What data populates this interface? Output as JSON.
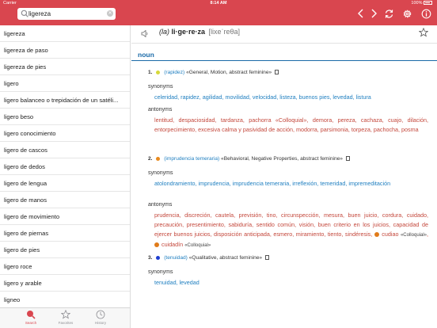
{
  "status": {
    "carrier": "Carrier",
    "time": "8:14 AM",
    "battery": "100%"
  },
  "search": {
    "value": "ligereza",
    "placeholder": "Search"
  },
  "list": [
    "ligereza",
    "ligereza de paso",
    "ligereza de pies",
    "ligero",
    "ligero balanceo o trepidación de un satéli...",
    "ligero beso",
    "ligero conocimiento",
    "ligero de cascos",
    "ligero de dedos",
    "ligero de lengua",
    "ligero de manos",
    "ligero de movimiento",
    "ligero de piernas",
    "ligero de pies",
    "ligero roce",
    "ligero y arable",
    "ligneo"
  ],
  "tabs": {
    "search": "Search",
    "favorites": "Favorites",
    "history": "History"
  },
  "entry": {
    "article": "(la)",
    "word": "li·ge·re·za",
    "ipa": "[lixeˈreθa]",
    "pos": "noun",
    "colors": {
      "accent": "#d9464f",
      "synonym": "#1f7fc0",
      "antonym": "#c4483c",
      "pos": "#1a6aa8"
    },
    "senses": [
      {
        "num": "1.",
        "dot": "#d7d93a",
        "gloss": "(rapidez)",
        "meta": "«General, Motion, abstract feminine»",
        "syn_label": "synonyms",
        "synonyms": [
          "celeridad",
          "rapidez",
          "agilidad",
          "movilidad",
          "velocidad",
          "listeza",
          "buenos pies",
          "levedad",
          "listura"
        ],
        "ant_label": "antonyms",
        "antonyms_text": "lentitud, despaciosidad, tardanza, pachorra «Colloquial», demora, pereza, cachaza, cuajo, dilación, entorpecimiento, excesiva calma y pasividad de acción, modorra, parsimonia, torpeza, pachocha, posma"
      },
      {
        "num": "2.",
        "dot": "#e88a1e",
        "gloss": "(imprudencia temeraria)",
        "meta": "«Behavioral, Negative Properties, abstract feminine»",
        "syn_label": "synonyms",
        "synonyms": [
          "atolondramiento",
          "imprudencia",
          "imprudencia temeraria",
          "irreflexión",
          "temeridad",
          "impremeditación"
        ],
        "ant_label": "antonyms",
        "antonyms_text": "prudencia, discreción, cautela, previsión, tino, circunspección, mesura, buen juicio, cordura, cuidado, precaución, presentimiento, sabiduría, sentido común, visión, buen criterio en los juicios, capacidad de ejercer buenos juicios, disposición anticipada, esmero, miramiento, tiento, sindéresis,",
        "ant_extra": [
          {
            "word": "cudiao",
            "note": "«Colloquial»"
          },
          {
            "word": "cuidadín",
            "note": "«Colloquial»"
          }
        ]
      },
      {
        "num": "3.",
        "dot": "#1f3fd1",
        "gloss": "(tenuidad)",
        "meta": "«Qualitative, abstract feminine»",
        "syn_label": "synonyms",
        "synonyms": [
          "tenuidad",
          "levedad"
        ]
      }
    ]
  }
}
